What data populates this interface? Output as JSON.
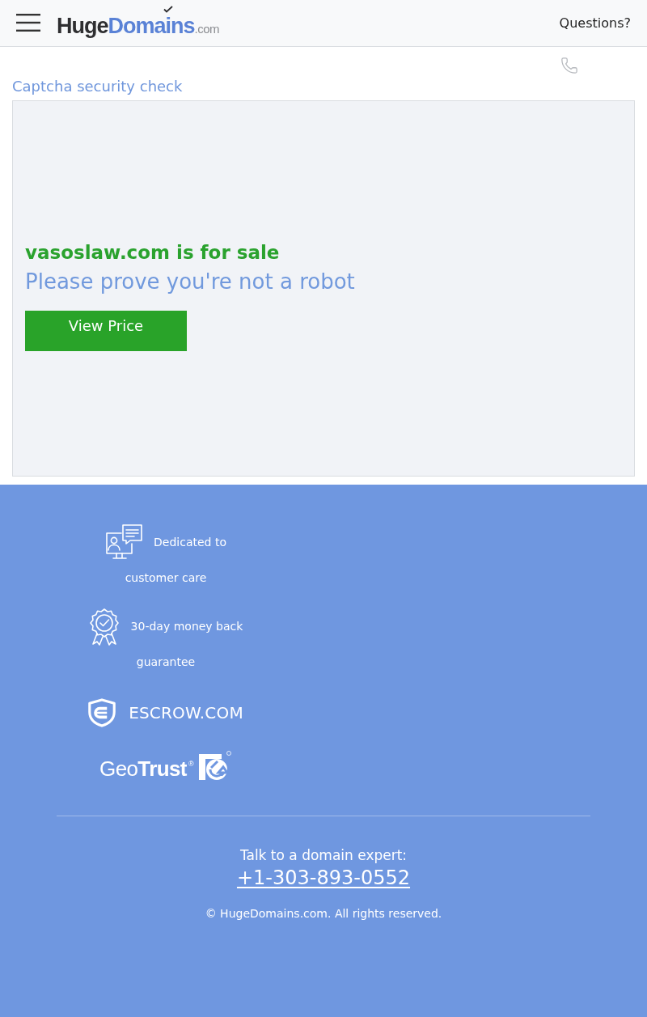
{
  "header": {
    "logo": {
      "part_1": "Huge",
      "part_2": "Domains",
      "part_3": ".com"
    },
    "link": "Questions?"
  },
  "main": {
    "title": "Captcha security check",
    "heading": "vasoslaw.com is for sale",
    "subheading": "Please prove you're not a robot",
    "button": "View Price"
  },
  "footer": {
    "features": [
      {
        "kind": "support",
        "text": "Dedicated to customer care"
      },
      {
        "kind": "guarantee",
        "text": "30-day money back guarantee"
      }
    ],
    "badges": [
      {
        "kind": "escrow",
        "text": "ESCROW.COM"
      },
      {
        "kind": "geotrust",
        "text": "Geo**Trust**$^{®}$"
      }
    ],
    "contact_label": "Talk to a domain expert:",
    "phone": "+1-303-893-0552",
    "copyright": "© HugeDomains.com. All rights reserved."
  }
}
